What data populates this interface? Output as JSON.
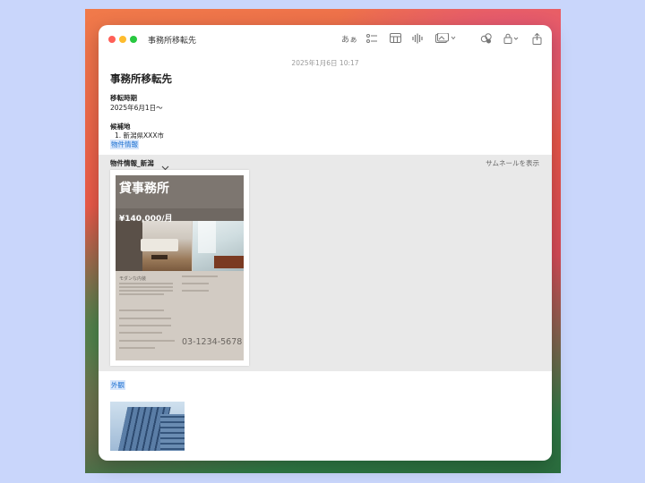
{
  "window": {
    "title": "事務所移転先"
  },
  "toolbar": {
    "font_button_label": "あぁ"
  },
  "note": {
    "timestamp": "2025年1月6日 10:17",
    "heading": "事務所移転先",
    "move_date_label": "移転時期",
    "move_date_value": "2025年6月1日〜",
    "candidate_label": "候補地",
    "candidate_item": "1. 新潟県XXX市",
    "property_link": "物件情報",
    "exterior_link": "外観"
  },
  "attachment": {
    "name": "物件情報_新潟",
    "thumbnail_toggle": "サムネールを表示"
  },
  "flyer": {
    "title": "貸事務所",
    "price": "¥140,000/月",
    "subtitle": "モダンな内装",
    "phone": "03-1234-5678"
  },
  "colors": {
    "accent_link": "#1a6fd1",
    "attachment_bg": "#e9e9e9"
  }
}
